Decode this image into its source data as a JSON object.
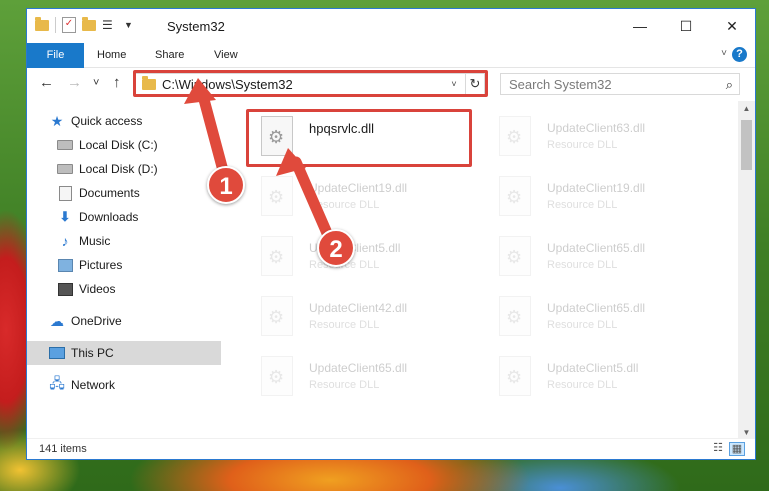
{
  "window": {
    "title": "System32",
    "controls": {
      "minimize": "—",
      "maximize": "☐",
      "close": "✕"
    }
  },
  "ribbon": {
    "tabs": [
      {
        "label": "File"
      },
      {
        "label": "Home"
      },
      {
        "label": "Share"
      },
      {
        "label": "View"
      }
    ],
    "help": "?"
  },
  "navigation": {
    "back": "←",
    "forward": "→",
    "recent": "˅",
    "up": "↑",
    "address": "C:\\Windows\\System32",
    "refresh": "↻",
    "search_placeholder": "Search System32"
  },
  "sidebar": {
    "items": [
      {
        "label": "Quick access",
        "icon": "star-icon"
      },
      {
        "label": "Local Disk (C:)",
        "icon": "drive-icon",
        "pinned": true
      },
      {
        "label": "Local Disk (D:)",
        "icon": "drive-icon",
        "pinned": true
      },
      {
        "label": "Documents",
        "icon": "documents-icon",
        "pinned": true
      },
      {
        "label": "Downloads",
        "icon": "downloads-icon",
        "pinned": true
      },
      {
        "label": "Music",
        "icon": "music-icon",
        "pinned": true
      },
      {
        "label": "Pictures",
        "icon": "pictures-icon",
        "pinned": true
      },
      {
        "label": "Videos",
        "icon": "videos-icon",
        "pinned": true
      },
      {
        "label": "OneDrive",
        "icon": "cloud-icon"
      },
      {
        "label": "This PC",
        "icon": "computer-icon",
        "selected": true
      },
      {
        "label": "Network",
        "icon": "network-icon"
      }
    ]
  },
  "files": {
    "highlighted": {
      "name": "hpqsrvlc.dll"
    },
    "background": [
      {
        "name": "UpdateClient63.dll",
        "type": "Resource DLL"
      },
      {
        "name": "UpdateClient19.dll",
        "type": "Resource DLL"
      },
      {
        "name": "UpdateClient19.dll",
        "type": "Resource DLL"
      },
      {
        "name": "UpdateClient5.dll",
        "type": "Resource DLL"
      },
      {
        "name": "UpdateClient65.dll",
        "type": "Resource DLL"
      },
      {
        "name": "UpdateClient42.dll",
        "type": "Resource DLL"
      },
      {
        "name": "UpdateClient65.dll",
        "type": "Resource DLL"
      },
      {
        "name": "UpdateClient65.dll",
        "type": "Resource DLL"
      },
      {
        "name": "UpdateClient5.dll",
        "type": "Resource DLL"
      }
    ]
  },
  "status": {
    "item_count": "141 items"
  },
  "annotations": {
    "step1": "1",
    "step2": "2"
  },
  "colors": {
    "accent": "#1979ca",
    "highlight": "#d9433b",
    "badge": "#e04a3c"
  }
}
